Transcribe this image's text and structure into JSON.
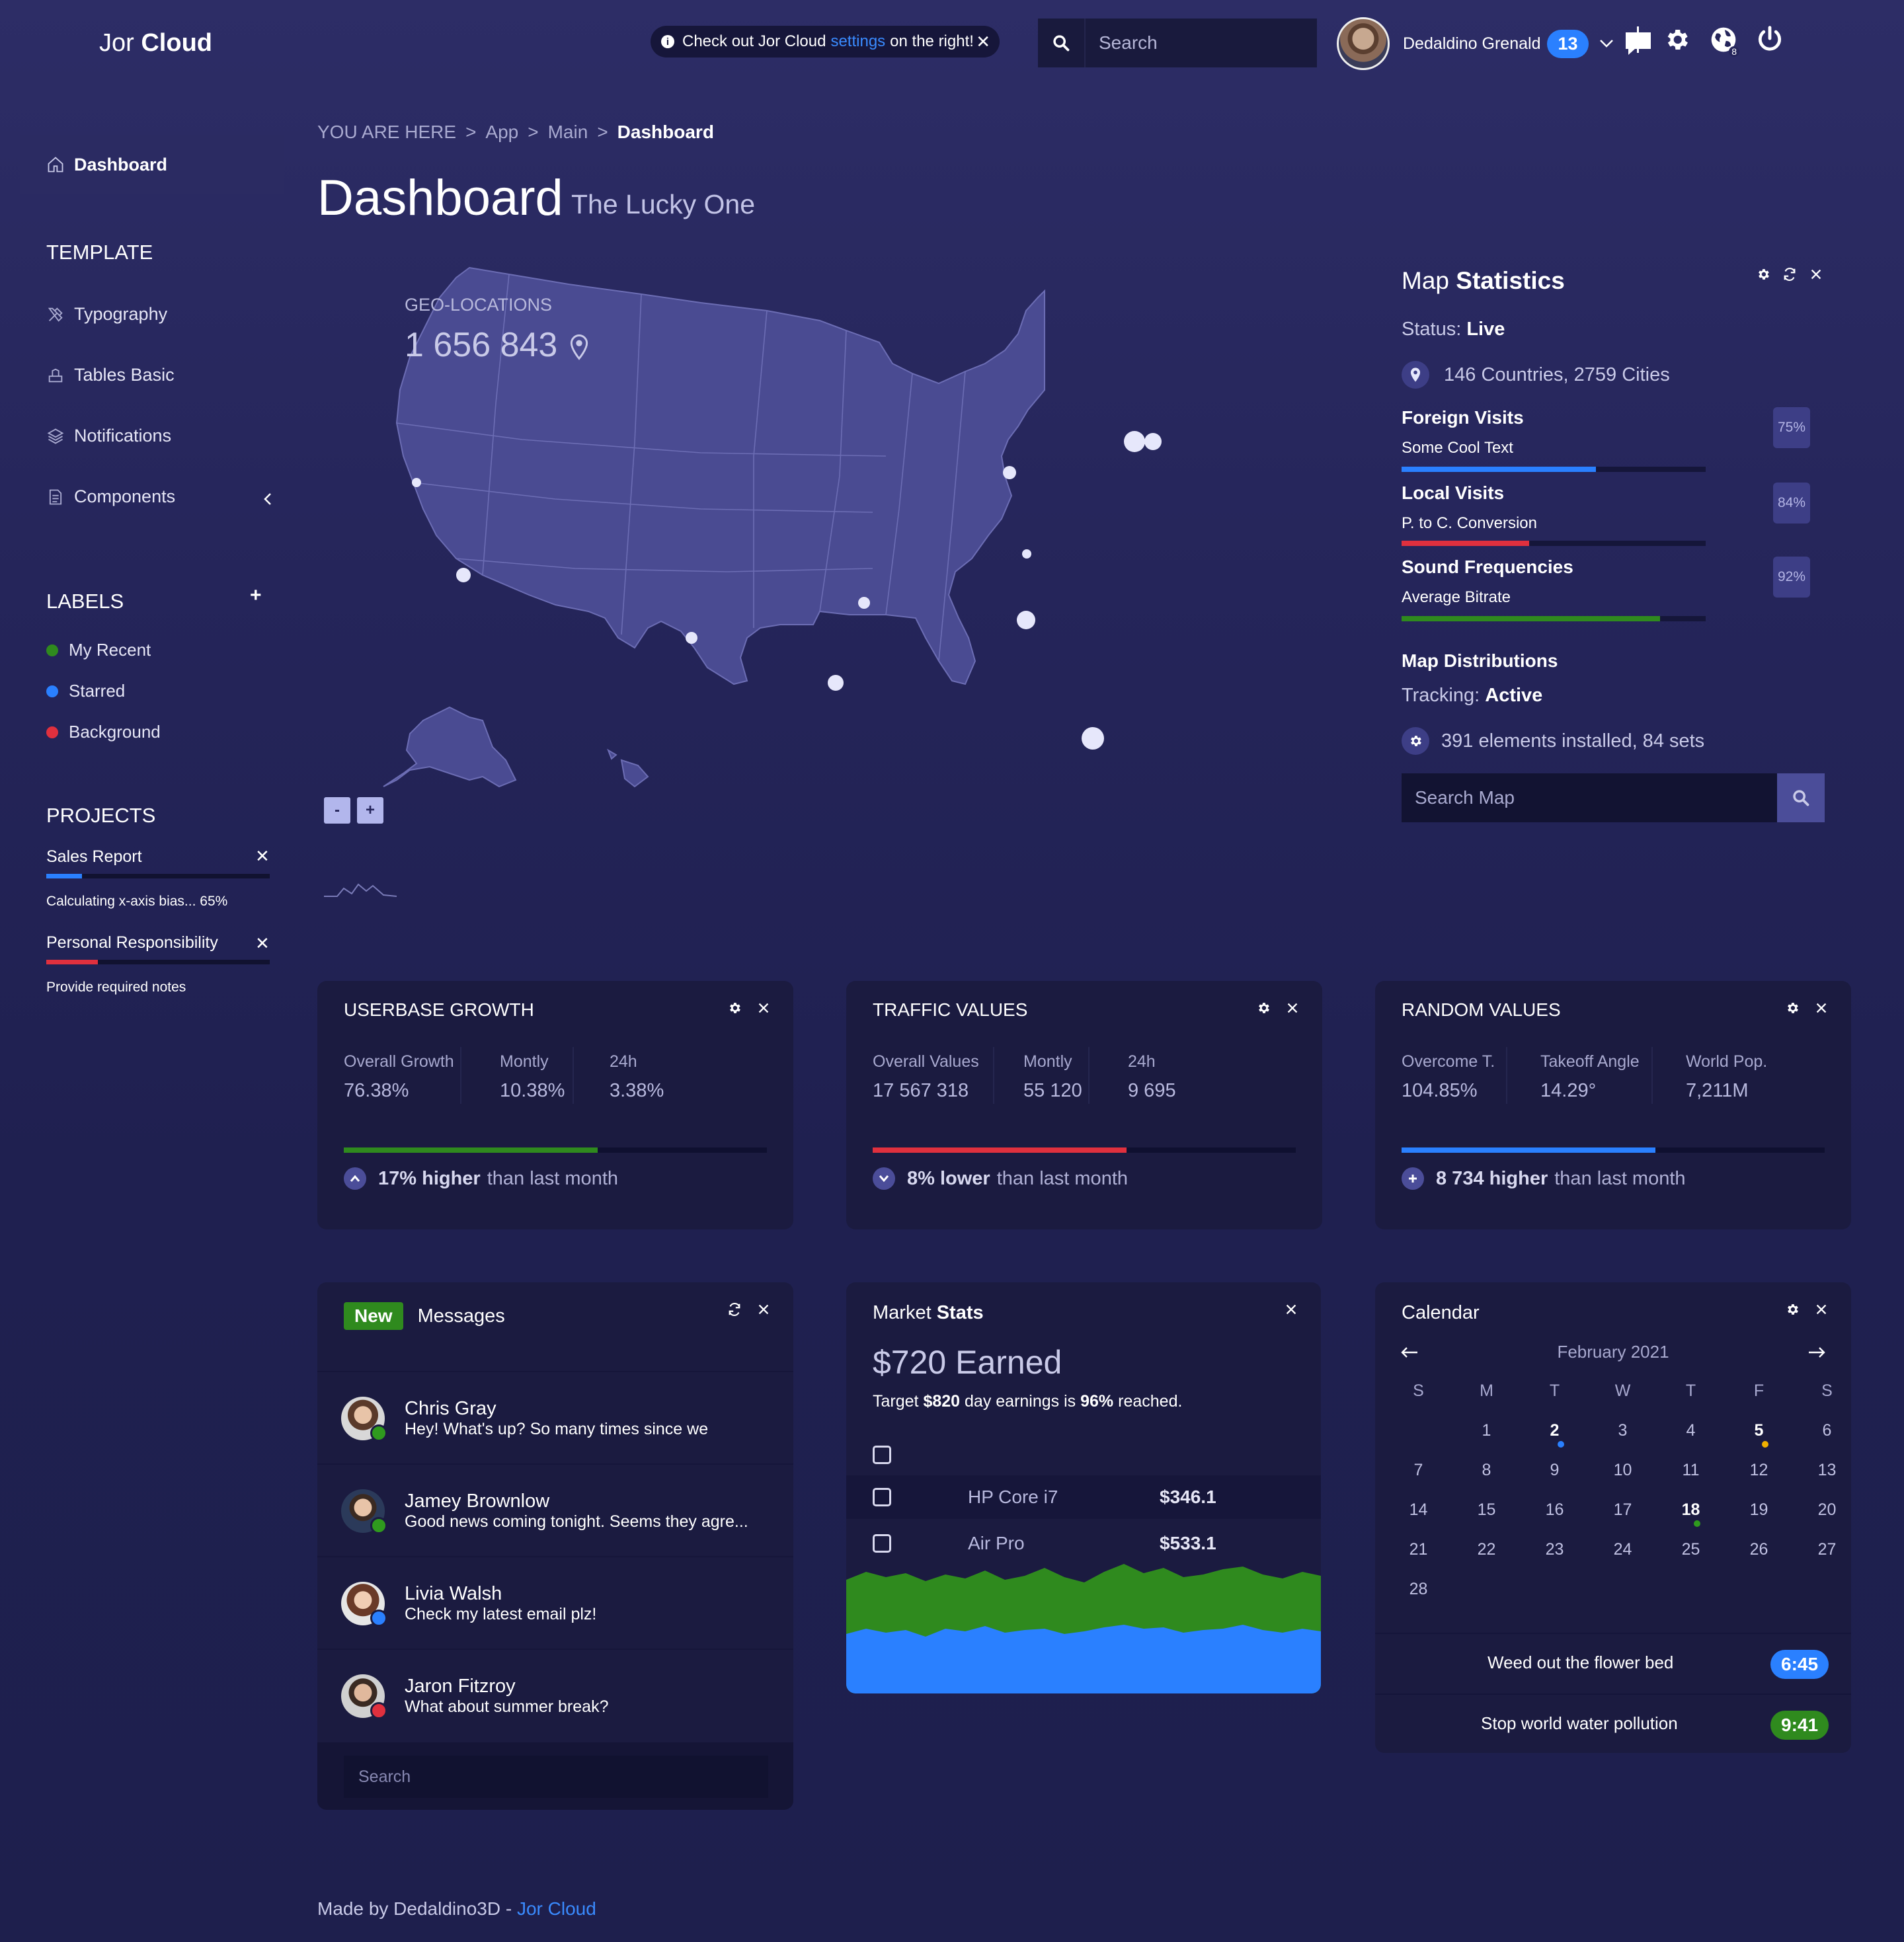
{
  "header": {
    "brand_light": "Jor",
    "brand_bold": "Cloud",
    "notice_pre": "Check out Jor Cloud",
    "notice_link": "settings",
    "notice_post": "on the right!",
    "search_placeholder": "Search",
    "user_name": "Dedaldino Grenald",
    "user_badge": "13",
    "globe_count": "8"
  },
  "sidebar": {
    "active": "Dashboard",
    "template_heading": "TEMPLATE",
    "template_items": [
      "Typography",
      "Tables Basic",
      "Notifications",
      "Components"
    ],
    "labels_heading": "LABELS",
    "labels": [
      {
        "name": "My Recent",
        "color": "#2f8a1e"
      },
      {
        "name": "Starred",
        "color": "#2a80ff"
      },
      {
        "name": "Background",
        "color": "#e0303e"
      }
    ],
    "projects_heading": "PROJECTS",
    "projects": [
      {
        "name": "Sales Report",
        "note": "Calculating x-axis bias... 65%",
        "progress": 0.16,
        "color": "#2a80ff"
      },
      {
        "name": "Personal Responsibility",
        "note": "Provide required notes",
        "progress": 0.23,
        "color": "#e0303e"
      }
    ]
  },
  "breadcrumb": {
    "items": [
      "YOU ARE HERE",
      "App",
      "Main"
    ],
    "current": "Dashboard"
  },
  "page": {
    "title": "Dashboard",
    "subtitle": "The Lucky One"
  },
  "map": {
    "label": "GEO-LOCATIONS",
    "value": "1 656 843",
    "zoom_out": "-",
    "zoom_in": "+"
  },
  "map_stats": {
    "title_light": "Map",
    "title_bold": "Statistics",
    "status_label": "Status:",
    "status_value": "Live",
    "coverage": "146 Countries, 2759 Cities",
    "stats": [
      {
        "name": "Foreign Visits",
        "sub": "Some Cool Text",
        "pct": "75%",
        "progress": 0.64,
        "color": "#2a80ff"
      },
      {
        "name": "Local Visits",
        "sub": "P. to C. Conversion",
        "pct": "84%",
        "progress": 0.42,
        "color": "#e0303e"
      },
      {
        "name": "Sound Frequencies",
        "sub": "Average Bitrate",
        "pct": "92%",
        "progress": 0.85,
        "color": "#2f8a1e"
      }
    ],
    "dist_title": "Map Distributions",
    "tracking_label": "Tracking:",
    "tracking_value": "Active",
    "elements": "391 elements installed, 84 sets",
    "search_placeholder": "Search Map"
  },
  "cards": [
    {
      "title": "USERBASE GROWTH",
      "cols": [
        {
          "label": "Overall Growth",
          "value": "76.38%"
        },
        {
          "label": "Montly",
          "value": "10.38%"
        },
        {
          "label": "24h",
          "value": "3.38%"
        }
      ],
      "progress": 0.6,
      "color": "#2f8a1e",
      "foot_bold": "17% higher",
      "foot_rest": "than last month"
    },
    {
      "title": "TRAFFIC VALUES",
      "cols": [
        {
          "label": "Overall Values",
          "value": "17 567 318"
        },
        {
          "label": "Montly",
          "value": "55 120"
        },
        {
          "label": "24h",
          "value": "9 695"
        }
      ],
      "progress": 0.6,
      "color": "#e0303e",
      "foot_bold": "8% lower",
      "foot_rest": "than last month"
    },
    {
      "title": "RANDOM VALUES",
      "cols": [
        {
          "label": "Overcome T.",
          "value": "104.85%"
        },
        {
          "label": "Takeoff Angle",
          "value": "14.29°"
        },
        {
          "label": "World Pop.",
          "value": "7,211M"
        }
      ],
      "progress": 0.6,
      "color": "#2a80ff",
      "foot_bold": "8 734 higher",
      "foot_rest": "than last month"
    }
  ],
  "messages": {
    "badge": "New",
    "title": "Messages",
    "items": [
      {
        "name": "Chris Gray",
        "text": "Hey! What's up? So many times since we",
        "status": "#2f9a1e"
      },
      {
        "name": "Jamey Brownlow",
        "text": "Good news coming tonight. Seems they agre...",
        "status": "#2f9a1e"
      },
      {
        "name": "Livia Walsh",
        "text": "Check my latest email plz!",
        "status": "#2a80ff"
      },
      {
        "name": "Jaron Fitzroy",
        "text": "What about summer break?",
        "status": "#e0303e"
      }
    ],
    "search_placeholder": "Search"
  },
  "market": {
    "title_light": "Market",
    "title_bold": "Stats",
    "earned": "$720 Earned",
    "target_pre": "Target",
    "target_amount": "$820",
    "target_mid": "day earnings is",
    "target_pct": "96%",
    "target_post": "reached.",
    "rows": [
      {
        "name": "HP Core i7",
        "price": "$346.1"
      },
      {
        "name": "Air Pro",
        "price": "$533.1"
      }
    ]
  },
  "calendar": {
    "title": "Calendar",
    "month": "February 2021",
    "dow": [
      "S",
      "M",
      "T",
      "W",
      "T",
      "F",
      "S"
    ],
    "tasks": [
      {
        "text": "Weed out the flower bed",
        "time": "6:45",
        "color": "#2a80ff"
      },
      {
        "text": "Stop world water pollution",
        "time": "9:41",
        "color": "#2f8a1e"
      }
    ]
  },
  "footer": {
    "text": "Made by Dedaldino3D -",
    "link": "Jor Cloud"
  }
}
